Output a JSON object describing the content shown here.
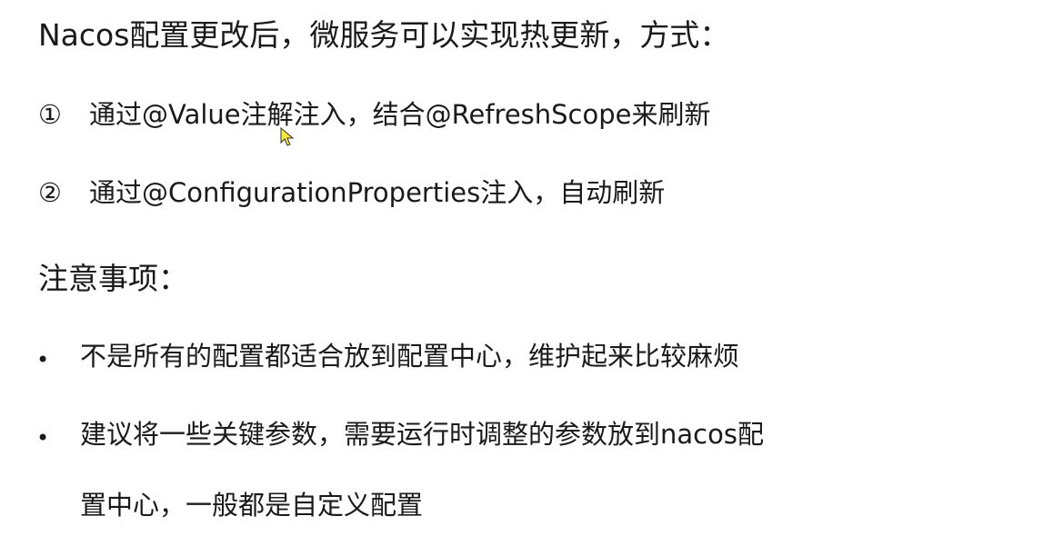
{
  "title": "Nacos配置更改后，微服务可以实现热更新，方式：",
  "methods": [
    {
      "marker": "①",
      "text": "通过@Value注解注入，结合@RefreshScope来刷新"
    },
    {
      "marker": "②",
      "text": "通过@ConfigurationProperties注入，自动刷新"
    }
  ],
  "notes": {
    "heading": "注意事项：",
    "items": [
      {
        "bullet": "•",
        "text": "不是所有的配置都适合放到配置中心，维护起来比较麻烦"
      },
      {
        "bullet": "•",
        "text": "建议将一些关键参数，需要运行时调整的参数放到nacos配",
        "continuation": "置中心，一般都是自定义配置"
      }
    ]
  },
  "cursor_icon": "mouse-pointer-icon",
  "colors": {
    "text": "#1a1a1a",
    "background": "#ffffff",
    "cursor_fill": "#f5e642"
  }
}
